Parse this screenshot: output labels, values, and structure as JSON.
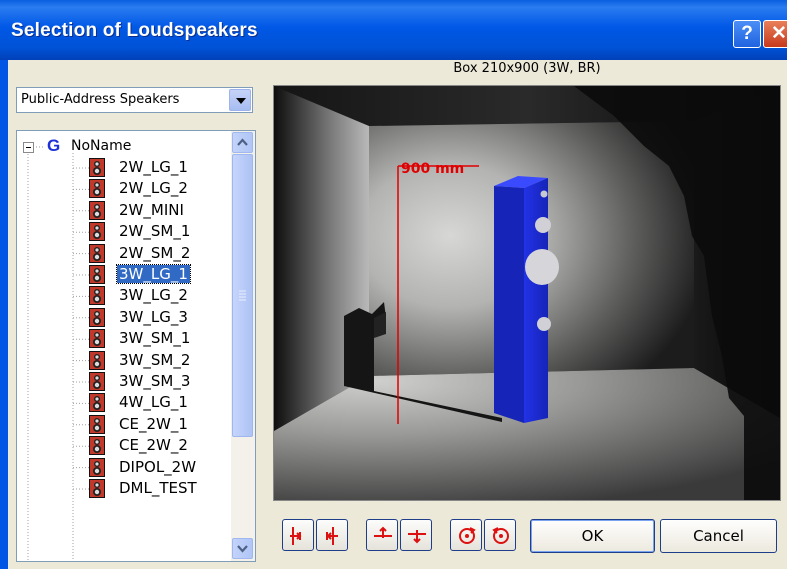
{
  "window": {
    "title": "Selection of Loudspeakers",
    "help_label": "?",
    "close_label": "✕"
  },
  "preview": {
    "caption": "Box 210x900 (3W, BR)",
    "dimension_label": "900 mm"
  },
  "category": {
    "selected": "Public-Address Speakers"
  },
  "tree": {
    "root_label": "NoName",
    "selected_index": 5,
    "items": [
      {
        "label": "2W_LG_1"
      },
      {
        "label": "2W_LG_2"
      },
      {
        "label": "2W_MINI"
      },
      {
        "label": "2W_SM_1"
      },
      {
        "label": "2W_SM_2"
      },
      {
        "label": "3W_LG_1"
      },
      {
        "label": "3W_LG_2"
      },
      {
        "label": "3W_LG_3"
      },
      {
        "label": "3W_SM_1"
      },
      {
        "label": "3W_SM_2"
      },
      {
        "label": "3W_SM_3"
      },
      {
        "label": "4W_LG_1"
      },
      {
        "label": "CE_2W_1"
      },
      {
        "label": "CE_2W_2"
      },
      {
        "label": "DIPOL_2W"
      },
      {
        "label": "DML_TEST"
      }
    ]
  },
  "toolbar": {
    "buttons": [
      {
        "name": "rotate-left-icon"
      },
      {
        "name": "rotate-right-icon"
      },
      {
        "name": "tilt-up-icon"
      },
      {
        "name": "tilt-down-icon"
      },
      {
        "name": "rotate-cw-icon"
      },
      {
        "name": "rotate-ccw-icon"
      }
    ],
    "ok_label": "OK",
    "cancel_label": "Cancel"
  },
  "colors": {
    "speaker_blue": "#1f2fd8",
    "dimension_red": "#e00000",
    "title_bar": "#0058e6",
    "selection": "#316ac5"
  }
}
